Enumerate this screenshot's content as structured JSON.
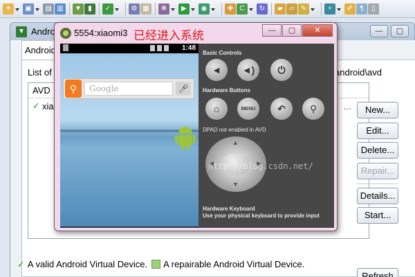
{
  "toolbar": {
    "icons": [
      "new-icon",
      "save-icon",
      "print-icon",
      "open-type-icon",
      "sdk-manager-icon",
      "avd-manager-icon",
      "task-icon",
      "debug-icon",
      "run-icon",
      "external-tools-icon",
      "new-class-icon",
      "open-folder-icon",
      "annotation-icon",
      "search-icon",
      "perspective-icon"
    ]
  },
  "avd_manager": {
    "title": "Android",
    "tab_label": "Android",
    "list_of_label": "List of",
    "path_suffix": "android\\avd",
    "table_header": "AVD",
    "rows": [
      {
        "name": "xia",
        "status": "valid"
      }
    ],
    "buttons": {
      "new": "New...",
      "edit": "Edit...",
      "delete": "Delete...",
      "repair": "Repair...",
      "details": "Details...",
      "start": "Start...",
      "refresh": "Refresh"
    },
    "legend_valid": "A valid Android Virtual Device.",
    "legend_repairable": "A repairable Android Virtual Device."
  },
  "emulator": {
    "title": "5554:xiaomi3",
    "annotation": "已经进入系统",
    "status_time": "1:48",
    "search_placeholder": "Google",
    "controls": {
      "basic_controls_label": "Basic Controls",
      "hardware_buttons_label": "Hardware Buttons",
      "menu_label": "MENU",
      "dpad_label": "DPAD not enabled in AVD",
      "keyboard_label": "Hardware Keyboard",
      "keyboard_hint": "Use your physical keyboard to provide input"
    }
  },
  "watermark": "http://blog.csdn.net/"
}
